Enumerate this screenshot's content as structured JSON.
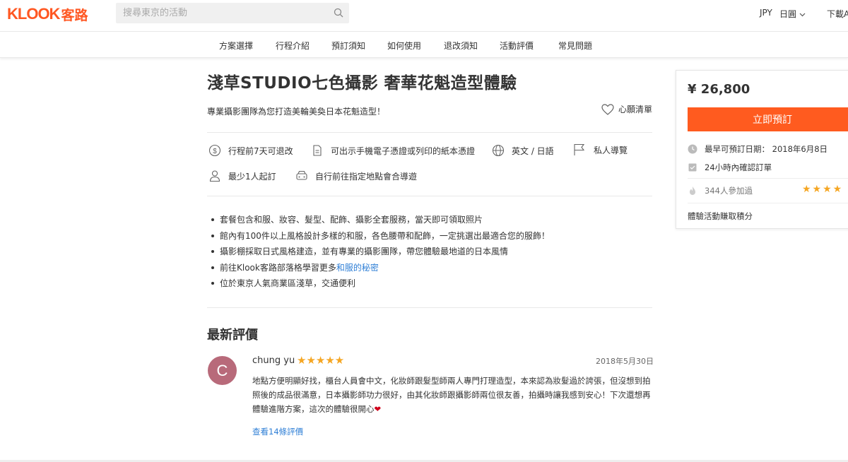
{
  "header": {
    "brand": "KLOOK",
    "brand_cn": "客路",
    "search_placeholder": "搜尋東京的活動",
    "currency": "JPY",
    "language": "日圓",
    "download": "下載A"
  },
  "subnav": {
    "items": [
      "方案選擇",
      "行程介紹",
      "預訂須知",
      "如何使用",
      "退改須知",
      "活動評價",
      "常見問題"
    ]
  },
  "activity": {
    "title": "淺草STUDIO七色攝影 奢華花魁造型體驗",
    "subtitle": "專業攝影團隊為您打造美輪美奐日本花魁造型！",
    "wishlist_label": "心願清單",
    "features": {
      "refund": "行程前7天可退改",
      "voucher": "可出示手機電子憑證或列印的紙本憑證",
      "language": "英文 / 日語",
      "guide": "私人導覽",
      "min_people": "最少1人起訂",
      "meeting": "自行前往指定地點會合導遊"
    },
    "highlights": [
      "套餐包含和服、妝容、髮型、配飾、攝影全套服務，當天即可領取照片",
      "館內有100件以上風格設計多樣的和服，各色腰帶和配飾，一定挑選出最適合您的服飾！",
      "攝影棚採取日式風格建造，並有專業的攝影團隊，帶您體驗最地道的日本風情"
    ],
    "highlight_link_prefix": "前往Klook客路部落格學習更多",
    "highlight_link_text": "和服的秘密",
    "highlight_last": "位於東京人氣商業區淺草，交通便利"
  },
  "reviews": {
    "section_title": "最新評價",
    "item": {
      "avatar_letter": "C",
      "name": "chung yu",
      "stars": "★★★★★",
      "date": "2018年5月30日",
      "body": "地點方便明顯好找，櫃台人員會中文，化妝師跟髮型師兩人專門打理造型，本來認為妝髮過於誇張，但沒想到拍照後的成品很滿意，日本攝影師功力很好，由其化妝師跟攝影師兩位很友善，拍攝時讓我感到安心！下次還想再體驗進階方案，這次的體驗很開心",
      "heart": "❤"
    },
    "more_link": "查看14條評價"
  },
  "booking": {
    "price": "¥ 26,800",
    "book_button": "立即預訂",
    "earliest_date": "最早可預訂日期： 2018年6月8日",
    "confirm": "24小時內確認訂單",
    "participants": "344人參加過",
    "rating_stars": "★★★★",
    "points": "體驗活動賺取積分"
  },
  "colors": {
    "brand": "#ff5722",
    "book_button": "#ff5b1f",
    "link": "#2f7fd6",
    "star": "#f5a623",
    "avatar": "#b86a7a"
  }
}
